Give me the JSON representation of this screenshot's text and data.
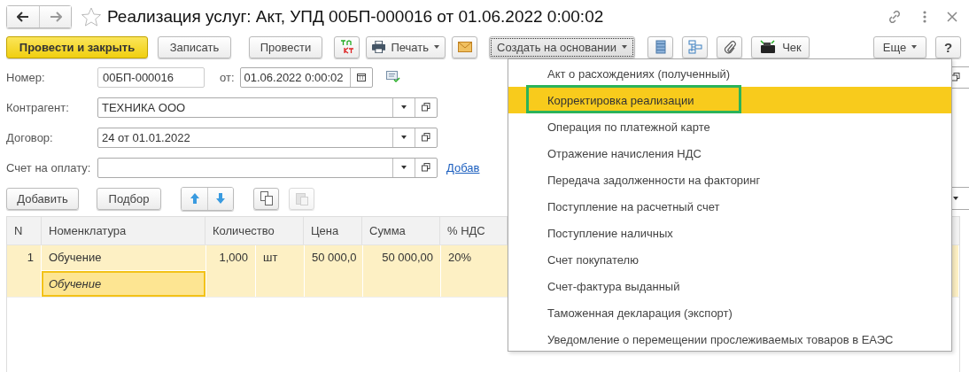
{
  "window": {
    "title": "Реализация услуг: Акт, УПД 00БП-000016 от 01.06.2022 0:00:02",
    "forward_disabled": true
  },
  "toolbar": {
    "post_close": "Провести и закрыть",
    "save": "Записать",
    "post": "Провести",
    "print": "Печать",
    "create_based": "Создать на основании",
    "receipt": "Чек",
    "more": "Еще",
    "help": "?"
  },
  "create_menu": {
    "expanded": true,
    "items": [
      {
        "label": "Акт о расхождениях (полученный)",
        "selected": false
      },
      {
        "label": "Корректировка реализации",
        "selected": true
      },
      {
        "label": "Операция по платежной карте",
        "selected": false
      },
      {
        "label": "Отражение начисления НДС",
        "selected": false
      },
      {
        "label": "Передача задолженности на факторинг",
        "selected": false
      },
      {
        "label": "Поступление на расчетный счет",
        "selected": false
      },
      {
        "label": "Поступление наличных",
        "selected": false
      },
      {
        "label": "Счет покупателю",
        "selected": false
      },
      {
        "label": "Счет-фактура выданный",
        "selected": false
      },
      {
        "label": "Таможенная декларация (экспорт)",
        "selected": false
      },
      {
        "label": "Уведомление о перемещении прослеживаемых товаров в ЕАЭС",
        "selected": false
      }
    ]
  },
  "form": {
    "number_label": "Номер:",
    "number": "00БП-000016",
    "date_label": "от:",
    "date": "01.06.2022  0:00:02",
    "counterparty_label": "Контрагент:",
    "counterparty": "ТЕХНИКА ООО",
    "contract_label": "Договор:",
    "contract": "24 от 01.01.2022",
    "invoice_label": "Счет на оплату:",
    "invoice_link": "Добав"
  },
  "table_toolbar": {
    "add": "Добавить",
    "pick": "Подбор",
    "paste_disabled": true
  },
  "table": {
    "columns": [
      "N",
      "Номенклатура",
      "Количество",
      "Цена",
      "Сумма",
      "% НДС"
    ],
    "rows": [
      {
        "n": "1",
        "item": "Обучение",
        "content": "Обучение",
        "quantity": "1,000",
        "unit": "шт",
        "price": "50 000,0",
        "sum": "50 000,00",
        "vat": "20%",
        "selected": true
      }
    ]
  }
}
